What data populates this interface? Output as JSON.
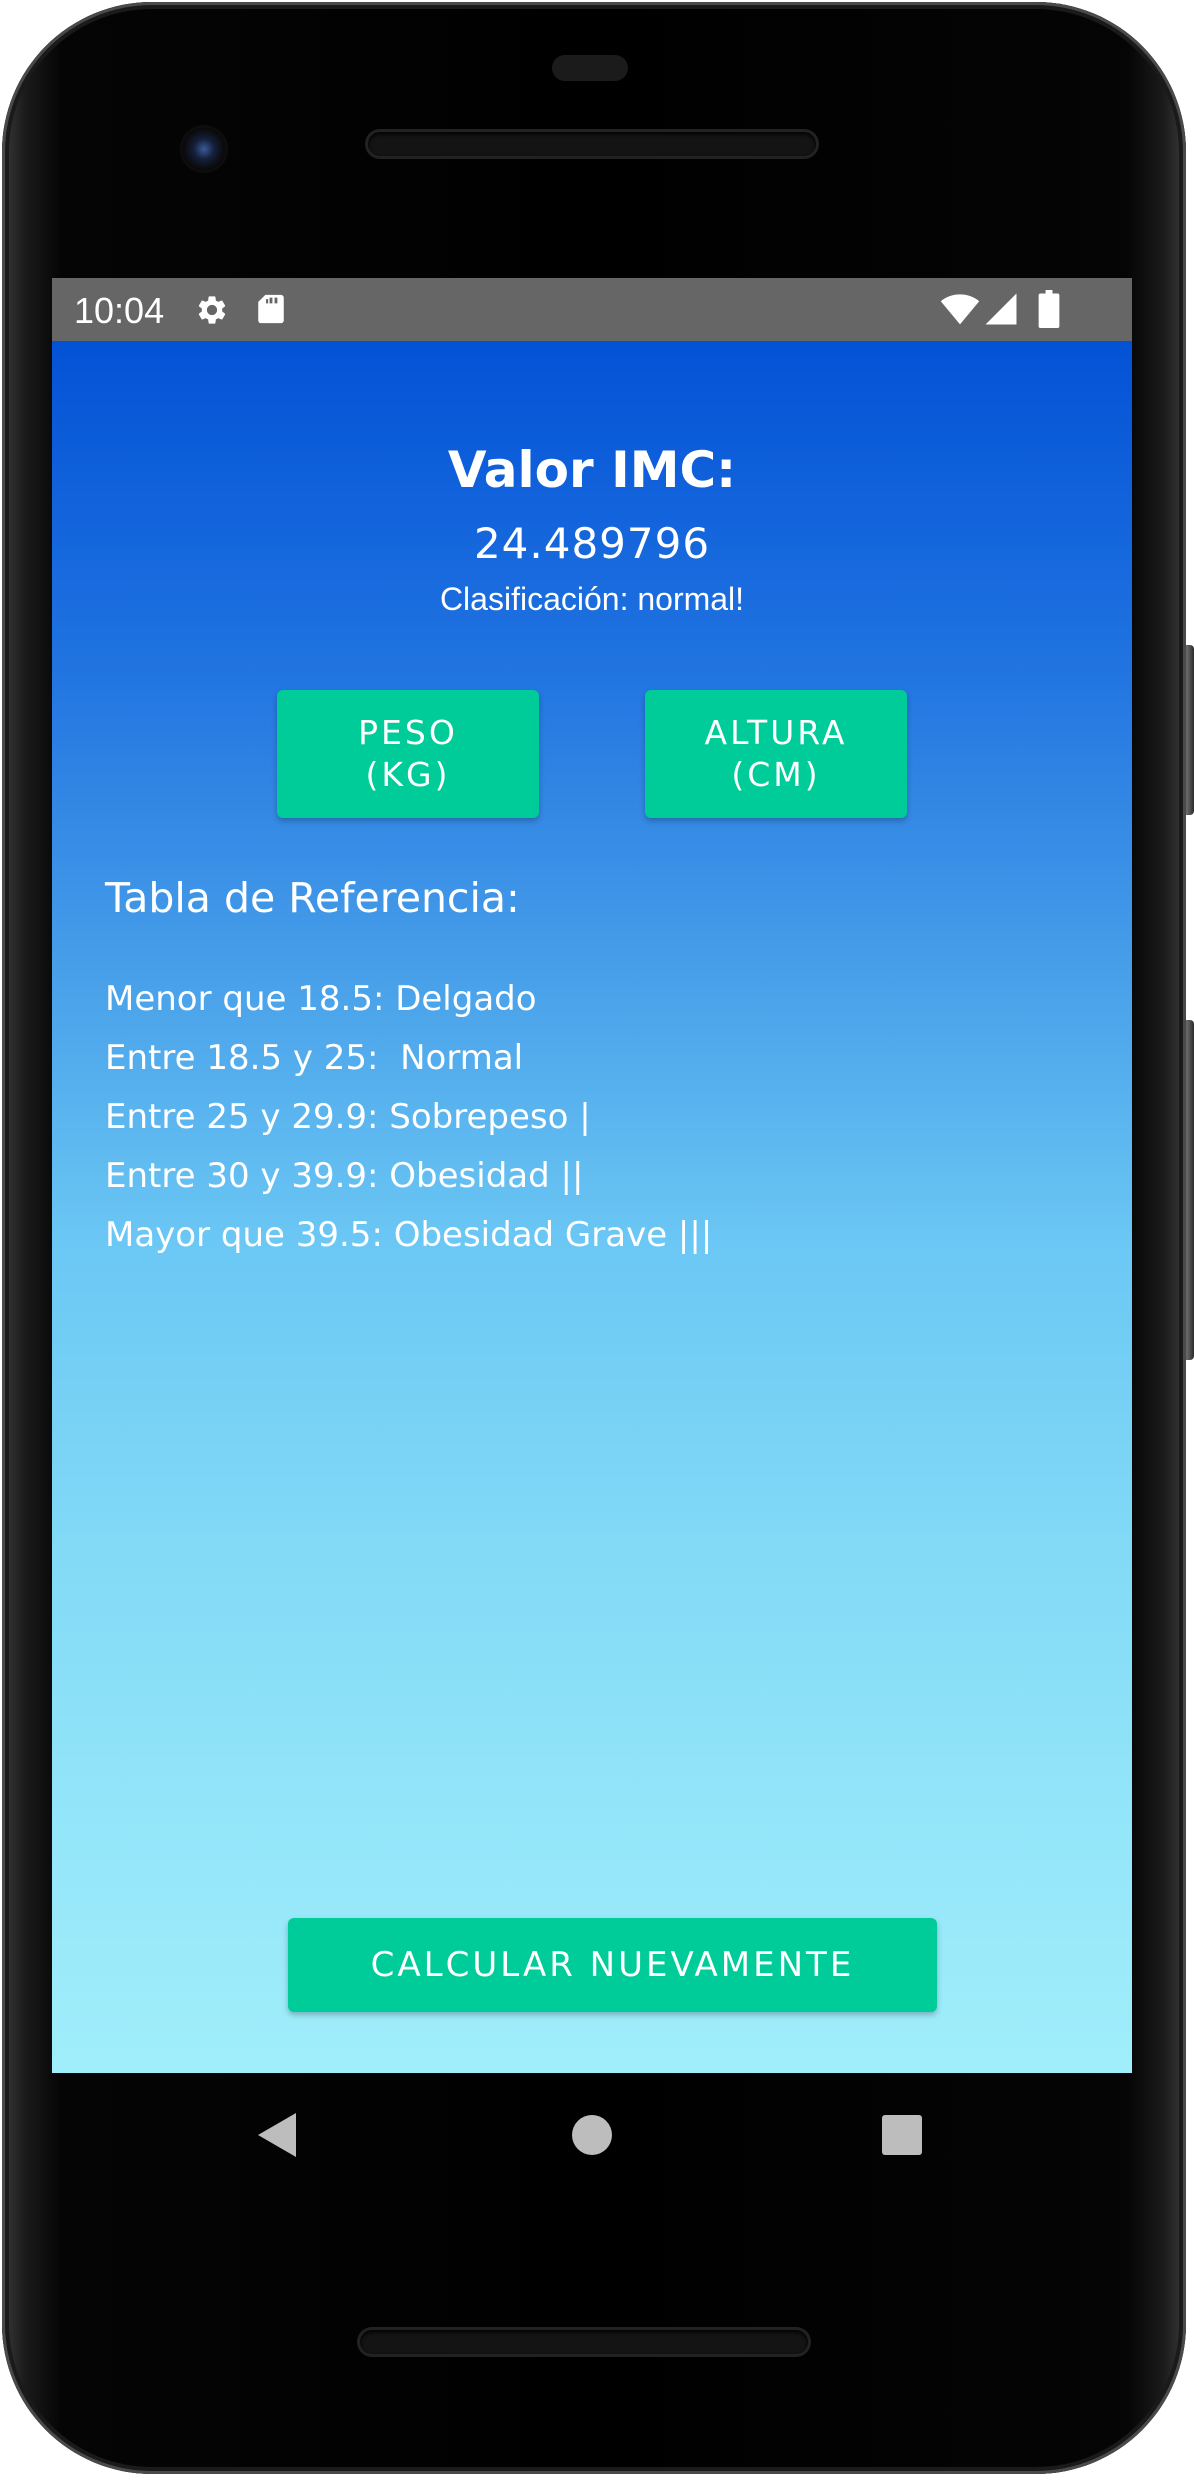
{
  "status_bar": {
    "time": "10:04",
    "left_icons": [
      "gear-icon",
      "sd-card-icon"
    ],
    "right_icons": [
      "wifi-icon",
      "signal-icon",
      "battery-icon"
    ]
  },
  "result": {
    "title": "Valor IMC:",
    "value": "24.489796",
    "classification": "Clasificación: normal!"
  },
  "buttons": {
    "peso_line1": "PESO",
    "peso_line2": "(KG)",
    "altura_line1": "ALTURA",
    "altura_line2": "(CM)",
    "recalc": "CALCULAR NUEVAMENTE"
  },
  "reference": {
    "title": "Tabla de Referencia:",
    "rows": [
      "Menor que 18.5: Delgado",
      "Entre 18.5 y 25:  Normal",
      "Entre 25 y 29.9: Sobrepeso |",
      "Entre 30 y 39.9: Obesidad ||",
      "Mayor que 39.5: Obesidad Grave |||"
    ]
  },
  "nav_bar": {
    "icons": [
      "back-icon",
      "home-icon",
      "recents-icon"
    ]
  },
  "colors": {
    "button": "#00cc99",
    "gradient_top": "#0352d6",
    "gradient_bottom": "#a0eefb",
    "status_bar": "#666666"
  }
}
